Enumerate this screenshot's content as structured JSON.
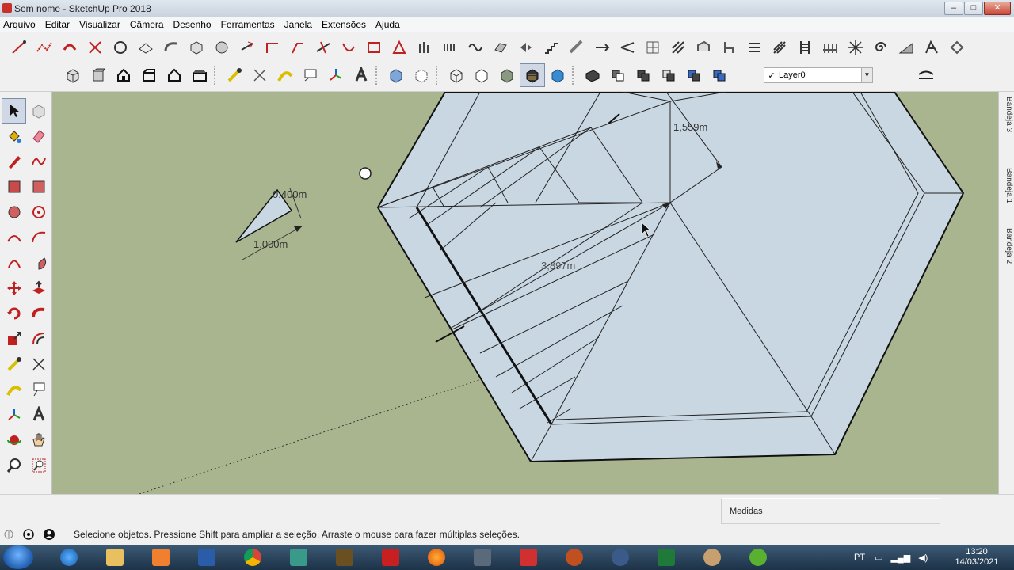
{
  "window": {
    "title": "Sem nome - SketchUp Pro 2018",
    "buttons": {
      "minimize": "–",
      "maximize": "□",
      "close": "✕"
    }
  },
  "menu": [
    "Arquivo",
    "Editar",
    "Visualizar",
    "Câmera",
    "Desenho",
    "Ferramentas",
    "Janela",
    "Extensões",
    "Ajuda"
  ],
  "layers": {
    "current": "Layer0",
    "check": "✓"
  },
  "viewport": {
    "background": "#a9b58f",
    "face_color": "#c9d7e2",
    "dimensions": [
      "1,559m",
      "3,897m",
      "0,400m",
      "1,000m"
    ]
  },
  "trays": [
    "Bandeja 3",
    "Bandeja 1",
    "Bandeja 2"
  ],
  "status": {
    "measurements_label": "Medidas",
    "hint": "Selecione objetos. Pressione Shift para ampliar a seleção. Arraste o mouse para fazer múltiplas seleções."
  },
  "taskbar": {
    "lang": "PT",
    "time": "13:20",
    "date": "14/03/2021"
  }
}
